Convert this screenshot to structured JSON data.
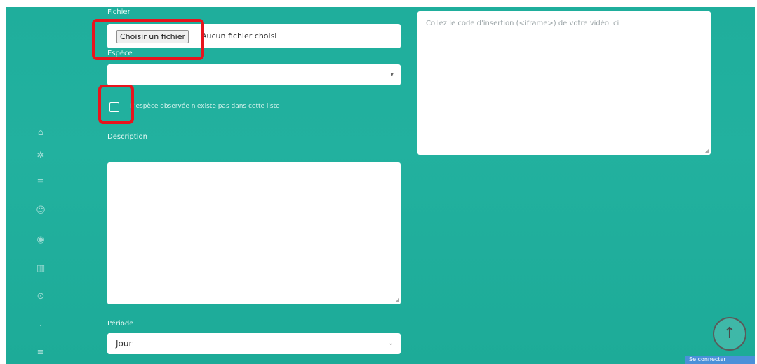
{
  "form": {
    "file_label": "Fichier",
    "file_button": "Choisir un fichier",
    "file_status": "Aucun fichier choisi",
    "species_label": "Espèce",
    "species_value": "",
    "checkbox_label": "L'espèce observée n'existe pas dans cette liste",
    "description_label": "Description",
    "description_value": "",
    "period_label": "Période",
    "period_value": "Jour",
    "embed_placeholder": "Collez le code d'insertion (<iframe>) de votre vidéo ici"
  },
  "sidebar": {
    "icons": [
      "home-icon",
      "settings-icon",
      "list-icon",
      "user-icon",
      "eye-icon",
      "grid-icon",
      "location-icon",
      "dot-icon",
      "menu-icon"
    ]
  },
  "misc": {
    "scroll_top_glyph": "↑",
    "badge_text": "Se connecter"
  },
  "colors": {
    "background": "#1fae9c",
    "highlight": "#e8141d"
  }
}
